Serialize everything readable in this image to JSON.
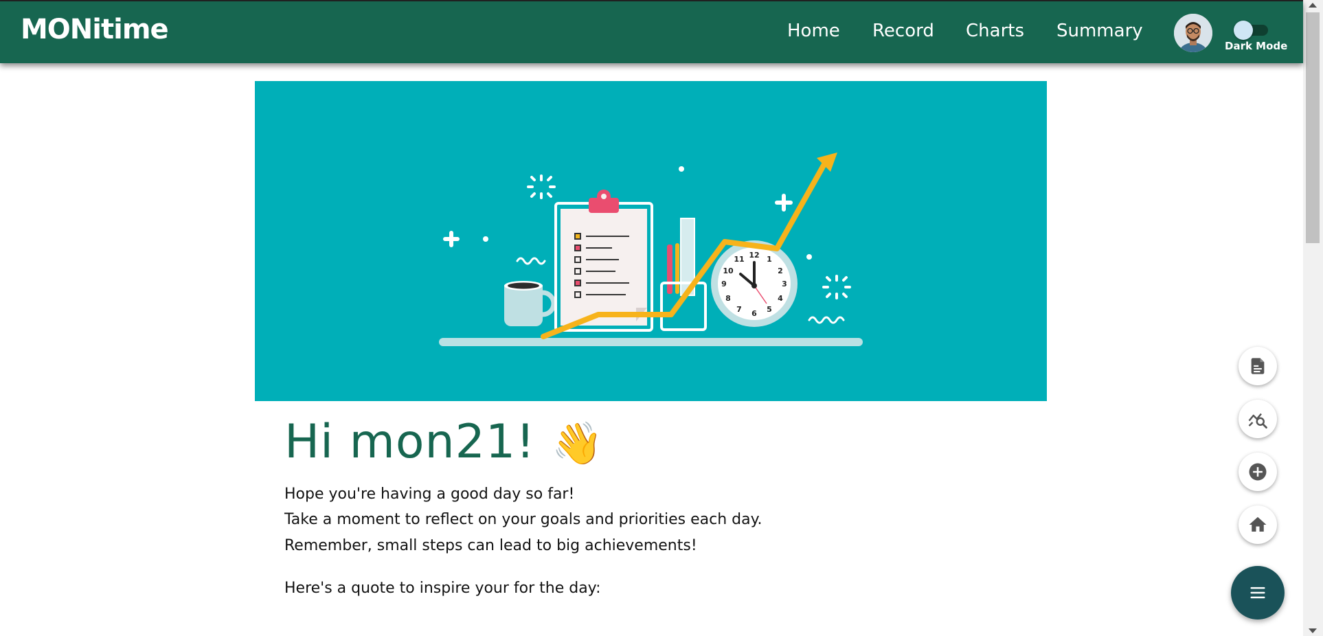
{
  "header": {
    "brand": "MONitime",
    "nav": [
      {
        "label": "Home"
      },
      {
        "label": "Record"
      },
      {
        "label": "Charts"
      },
      {
        "label": "Summary"
      }
    ],
    "toggle_label": "Dark Mode",
    "toggle_on": false
  },
  "hero": {
    "clock_numbers": [
      "12",
      "1",
      "2",
      "3",
      "4",
      "5",
      "6",
      "7",
      "8",
      "9",
      "10",
      "11"
    ]
  },
  "main": {
    "greeting": "Hi mon21!",
    "wave_emoji": "👋",
    "lines": [
      "Hope you're having a good day so far!",
      "Take a moment to reflect on your goals and priorities each day.",
      "Remember, small steps can lead to big achievements!"
    ],
    "quote_intro": "Here's a quote to inspire your for the day:"
  },
  "fabs": [
    {
      "icon": "document-icon"
    },
    {
      "icon": "chart-search-icon"
    },
    {
      "icon": "add-circle-icon"
    },
    {
      "icon": "home-icon"
    },
    {
      "icon": "menu-icon"
    }
  ],
  "colors": {
    "header": "#176650",
    "hero": "#00afb8",
    "accent_arrow": "#f7b31b",
    "greeting": "#176650",
    "fab_main": "#1a5259"
  }
}
